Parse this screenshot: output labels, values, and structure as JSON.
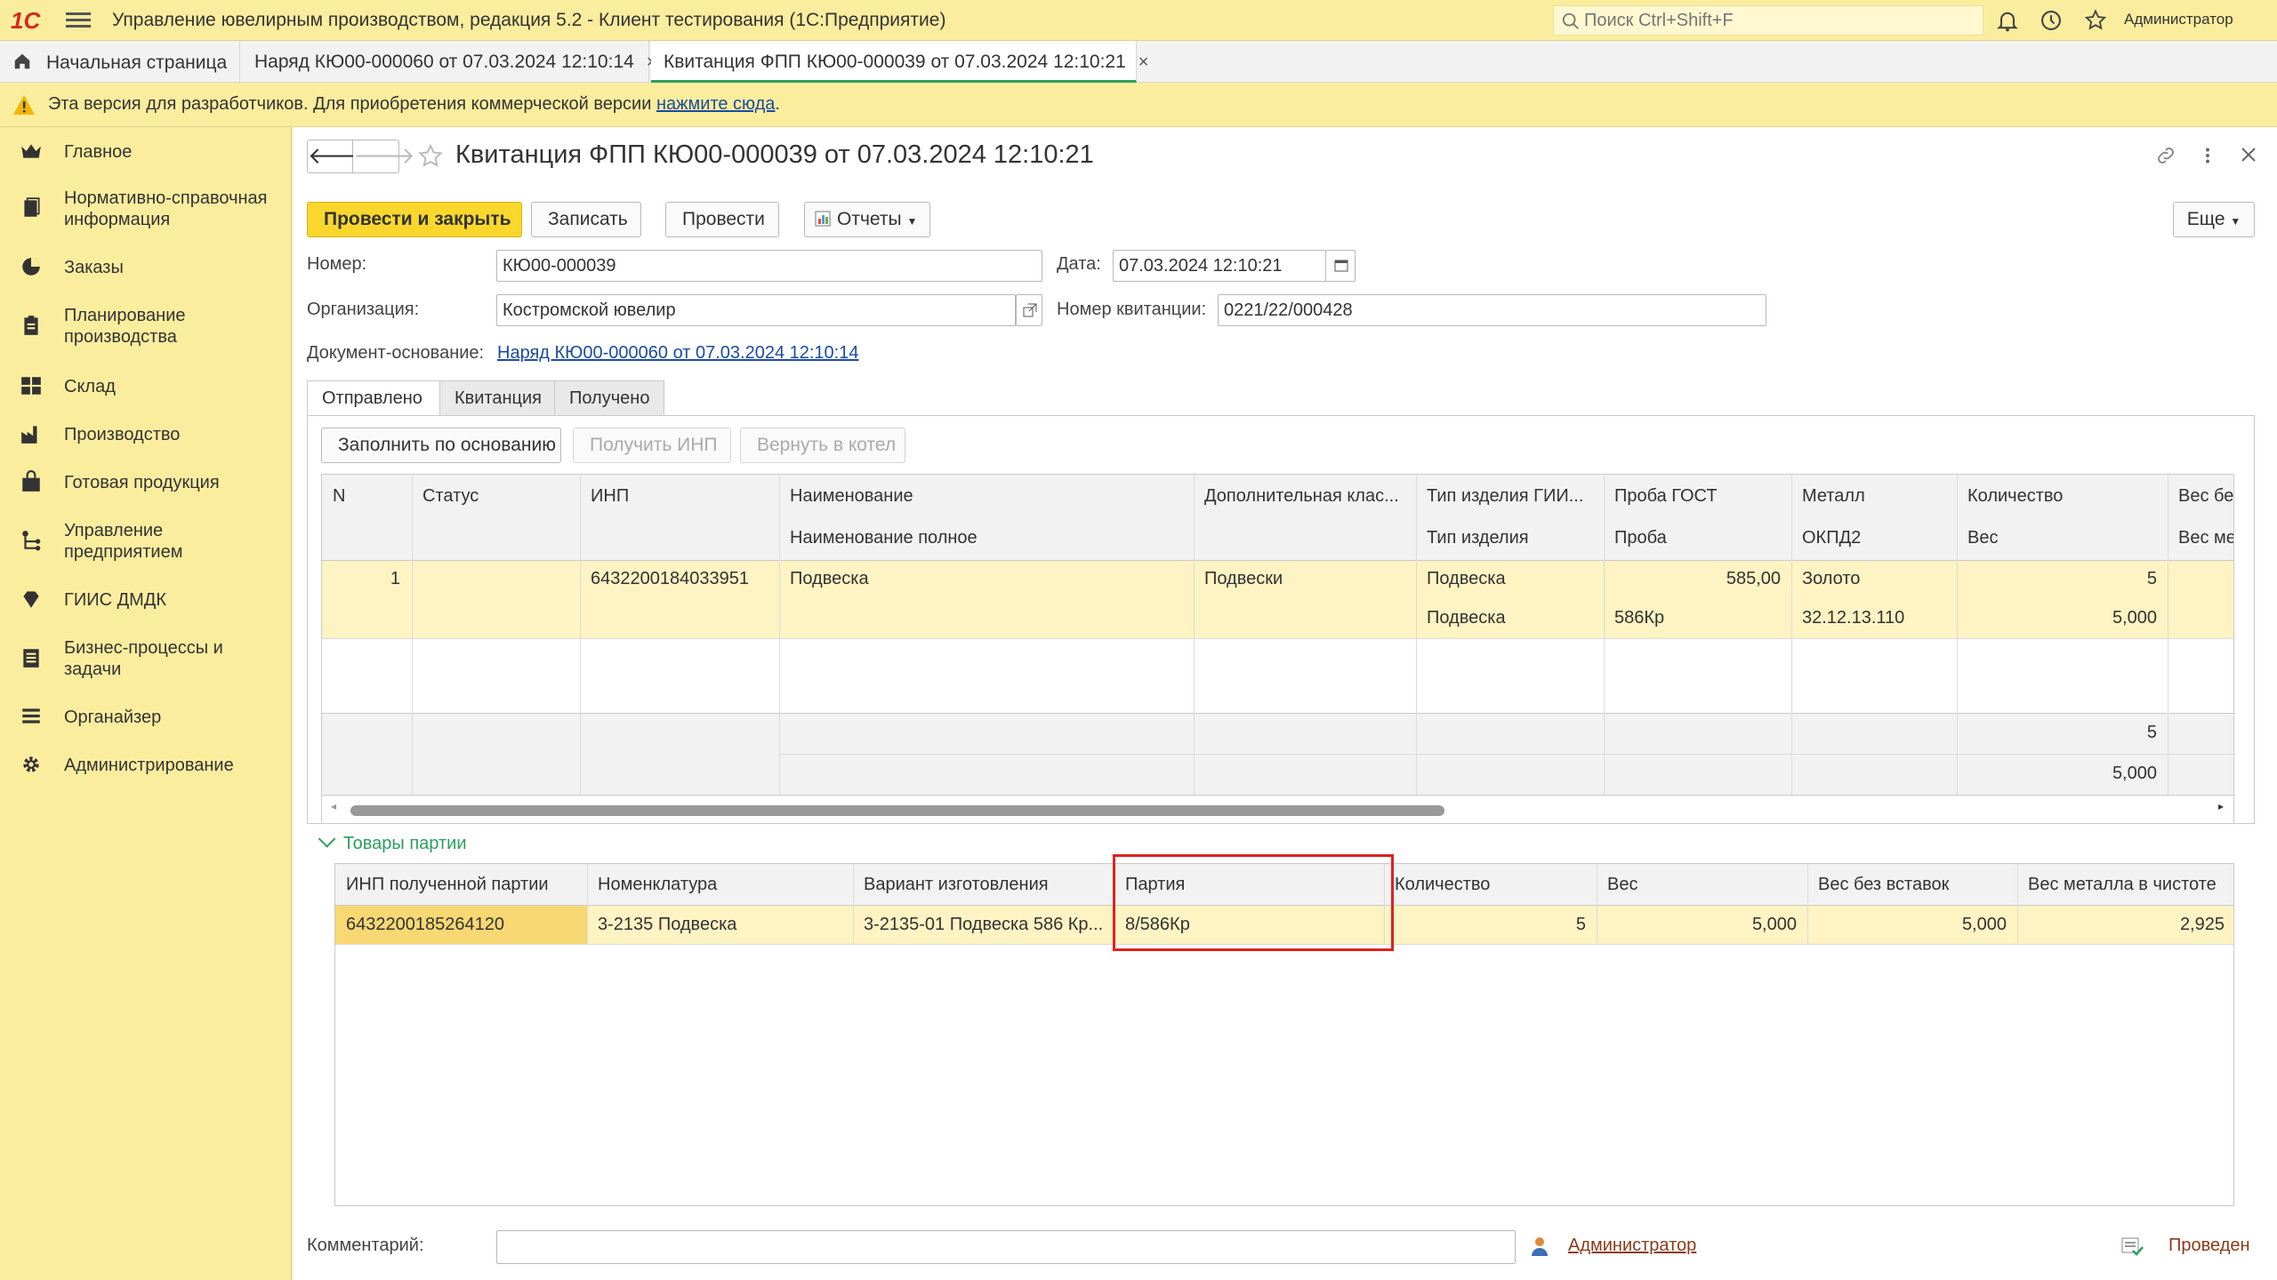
{
  "app": {
    "title": "Управление ювелирным производством, редакция 5.2  - Клиент тестирования (1С:Предприятие)",
    "logo": "1С",
    "search_placeholder": "Поиск Ctrl+Shift+F",
    "user": "Администратор"
  },
  "window_tabs": [
    {
      "label": "Начальная страница"
    },
    {
      "label": "Наряд КЮ00-000060 от 07.03.2024 12:10:14"
    },
    {
      "label": "Квитанция ФПП КЮ00-000039 от 07.03.2024 12:10:21"
    }
  ],
  "notice": {
    "text": "Эта версия для разработчиков. Для приобретения коммерческой версии ",
    "link": "нажмите сюда",
    "tail": "."
  },
  "sidebar": {
    "items": [
      {
        "label": "Главное",
        "icon": "crown-icon"
      },
      {
        "label": "Нормативно-справочная информация",
        "icon": "books-icon"
      },
      {
        "label": "Заказы",
        "icon": "pie-icon"
      },
      {
        "label": "Планирование производства",
        "icon": "clipboard-icon"
      },
      {
        "label": "Склад",
        "icon": "grid-icon"
      },
      {
        "label": "Производство",
        "icon": "factory-icon"
      },
      {
        "label": "Готовая продукция",
        "icon": "bag-icon"
      },
      {
        "label": "Управление предприятием",
        "icon": "org-icon"
      },
      {
        "label": "ГИИС ДМДК",
        "icon": "diamond-icon"
      },
      {
        "label": "Бизнес-процессы и задачи",
        "icon": "tasks-icon"
      },
      {
        "label": "Органайзер",
        "icon": "organizer-icon"
      },
      {
        "label": "Администрирование",
        "icon": "gear-icon"
      }
    ]
  },
  "document": {
    "title": "Квитанция ФПП КЮ00-000039 от 07.03.2024 12:10:21",
    "buttons": {
      "post_close": "Провести и закрыть",
      "save": "Записать",
      "post": "Провести",
      "reports": "Отчеты",
      "more": "Еще"
    },
    "fields": {
      "number_label": "Номер:",
      "number": "КЮ00-000039",
      "date_label": "Дата:",
      "date": "07.03.2024 12:10:21",
      "org_label": "Организация:",
      "org": "Костромской ювелир",
      "receipt_no_label": "Номер квитанции:",
      "receipt_no": "0221/22/000428",
      "basis_label": "Документ-основание:",
      "basis": "Наряд КЮ00-000060 от 07.03.2024 12:10:14"
    },
    "tabs": [
      "Отправлено",
      "Квитанция",
      "Получено"
    ],
    "panel_buttons": {
      "fill": "Заполнить по основанию",
      "get_inp": "Получить ИНП",
      "return": "Вернуть в котел"
    },
    "table1": {
      "headers_top": [
        "N",
        "Статус",
        "ИНП",
        "Наименование",
        "Дополнительная клас...",
        "Тип изделия ГИИ...",
        "Проба ГОСТ",
        "Металл",
        "Количество",
        "Вес бе"
      ],
      "headers_bottom": [
        "",
        "",
        "",
        "Наименование полное",
        "",
        "Тип изделия",
        "Проба",
        "ОКПД2",
        "Вес",
        "Вес ме"
      ],
      "row": {
        "n": "1",
        "inp": "6432200184033951",
        "name": "Подвеска",
        "extra_class": "Подвески",
        "type_giis": "Подвеска",
        "type": "Подвеска",
        "gost": "585,00",
        "probe": "586Кр",
        "metal": "Золото",
        "okpd": "32.12.13.110",
        "qty": "5",
        "weight": "5,000"
      },
      "totals": {
        "qty": "5",
        "weight": "5,000"
      }
    },
    "batch_section": "Товары партии",
    "table2": {
      "headers": [
        "ИНП полученной партии",
        "Номенклатура",
        "Вариант изготовления",
        "Партия",
        "Количество",
        "Вес",
        "Вес без вставок",
        "Вес металла в чистоте"
      ],
      "row": [
        "6432200185264120",
        "3-2135 Подвеска",
        "3-2135-01 Подвеска 586 Кр...",
        "8/586Кр",
        "5",
        "5,000",
        "5,000",
        "2,925"
      ]
    },
    "footer": {
      "comment_label": "Комментарий:",
      "user": "Администратор",
      "status": "Проведен"
    }
  },
  "colors": {
    "accent_yellow": "#f9d72d",
    "panel_yellow": "#fbed9e",
    "row_highlight": "#fdf3c3",
    "active_tab": "#2e9e5e",
    "highlight_box": "#e02020"
  }
}
